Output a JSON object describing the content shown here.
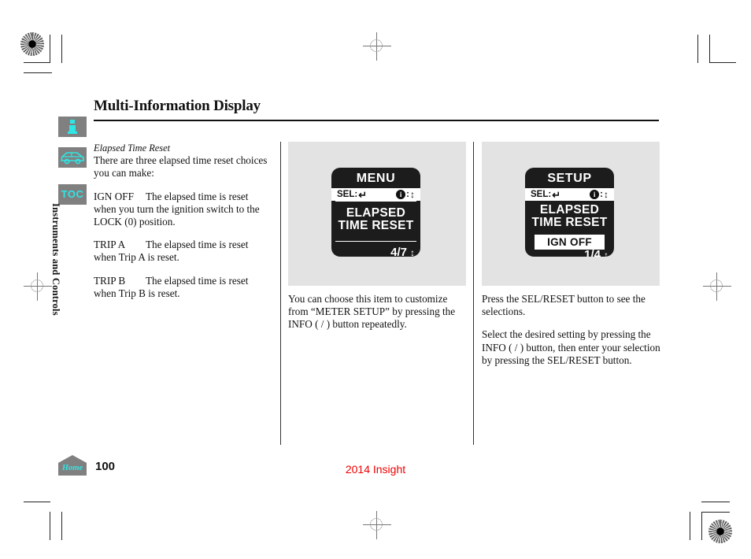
{
  "document": {
    "section_title": "Multi-Information Display",
    "page_number": "100",
    "model_name": "2014 Insight",
    "home_label": "Home",
    "vertical_tab_label": "Instruments and Controls",
    "toc_label": "TOC"
  },
  "rail": {
    "info_icon": "info-i-icon",
    "vehicle_icon": "car-outline-icon",
    "toc_icon": "toc-icon"
  },
  "left_column": {
    "subheading": "Elapsed Time Reset",
    "intro": "There are three elapsed time reset choices you can make:",
    "items": [
      {
        "term": "IGN OFF",
        "desc": "The elapsed time is reset when you turn the ignition switch to the LOCK (0) position."
      },
      {
        "term": "TRIP A",
        "desc": "The elapsed time is reset when Trip A is reset."
      },
      {
        "term": "TRIP B",
        "desc": "The elapsed time is reset when Trip B is reset."
      }
    ]
  },
  "middle_column": {
    "screen": {
      "title": "MENU",
      "sel_label": "SEL:",
      "sel_glyph": "return-arrow-glyph",
      "info_glyph": "i",
      "info_separator": ":",
      "updown_glyph": "up-down-arrow-glyph",
      "item_line1": "ELAPSED",
      "item_line2": "TIME RESET",
      "page_indicator": "4/7"
    },
    "caption": "You can choose this item to customize from “METER SETUP” by pressing the INFO (   /   ) button  repeatedly."
  },
  "right_column": {
    "screen": {
      "title": "SETUP",
      "sel_label": "SEL:",
      "sel_glyph": "return-arrow-glyph",
      "info_glyph": "i",
      "info_separator": ":",
      "updown_glyph": "up-down-arrow-glyph",
      "item_line1": "ELAPSED",
      "item_line2": "TIME RESET",
      "selected_value": "IGN OFF",
      "page_indicator": "1/4"
    },
    "caption_1": "Press the SEL/RESET button to see the selections.",
    "caption_2": "Select the desired setting by pressing the INFO (   /   ) button, then enter your selection by pressing the SEL/RESET button."
  },
  "colors": {
    "accent_cyan": "#2ee6e6",
    "tab_gray": "#808080",
    "panel_gray": "#e3e3e3",
    "model_red": "#ee0000",
    "lcd_black": "#1c1c1c"
  }
}
